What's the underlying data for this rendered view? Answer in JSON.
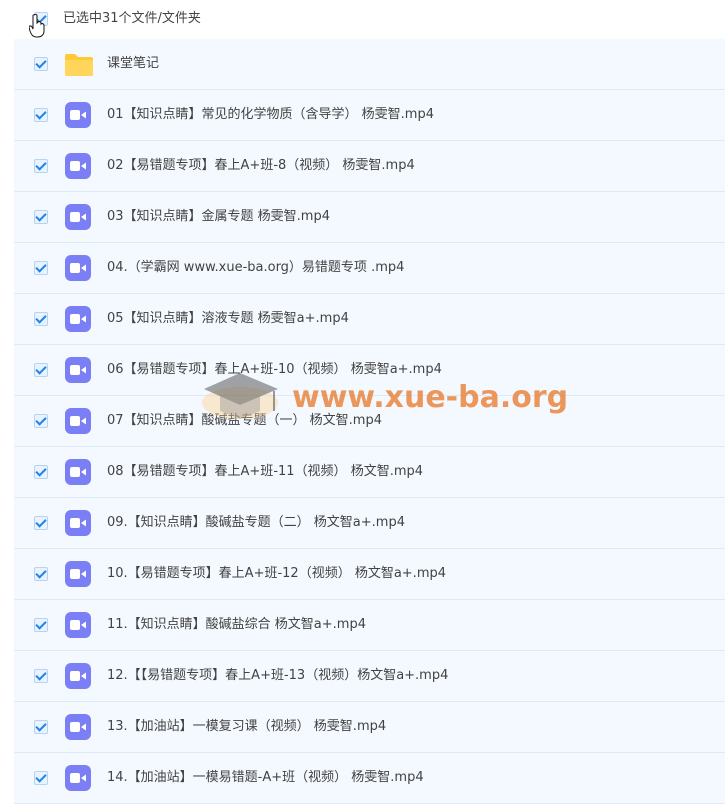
{
  "header": {
    "selection_label": "已选中31个文件/文件夹"
  },
  "folder": {
    "name": "课堂笔记"
  },
  "files": [
    {
      "name": "01【知识点睛】常见的化学物质（含导学） 杨雯智.mp4"
    },
    {
      "name": "02【易错题专项】春上A+班-8（视频） 杨雯智.mp4"
    },
    {
      "name": "03【知识点睛】金属专题 杨雯智.mp4"
    },
    {
      "name": "04.（学霸网 www.xue-ba.org）易错题专项 .mp4"
    },
    {
      "name": "05【知识点睛】溶液专题 杨雯智a+.mp4"
    },
    {
      "name": "06【易错题专项】春上A+班-10（视频） 杨雯智a+.mp4"
    },
    {
      "name": "07【知识点睛】酸碱盐专题（一） 杨文智.mp4"
    },
    {
      "name": "08【易错题专项】春上A+班-11（视频） 杨文智.mp4"
    },
    {
      "name": "09.【知识点睛】酸碱盐专题（二） 杨文智a+.mp4"
    },
    {
      "name": "10.【易错题专项】春上A+班-12（视频） 杨文智a+.mp4"
    },
    {
      "name": "11.【知识点睛】酸碱盐综合 杨文智a+.mp4"
    },
    {
      "name": "12.【【易错题专项】春上A+班-13（视频）杨文智a+.mp4"
    },
    {
      "name": "13.【加油站】一模复习课（视频） 杨雯智.mp4"
    },
    {
      "name": "14.【加油站】一模易错题-A+班（视频） 杨雯智.mp4"
    }
  ],
  "watermark": {
    "text": "www.xue-ba.org"
  },
  "icons": {
    "folder": "folder-icon",
    "video": "video-file-icon",
    "checkbox": "checkbox-checked-icon",
    "cursor": "hand-cursor-icon"
  },
  "colors": {
    "row_background": "#f4f9ff",
    "row_divider": "#dcebfa",
    "checkbox_accent": "#1f83e8",
    "video_icon": "#7a7ff5",
    "folder_icon": "#ffcc45",
    "watermark": "#e7701c"
  }
}
